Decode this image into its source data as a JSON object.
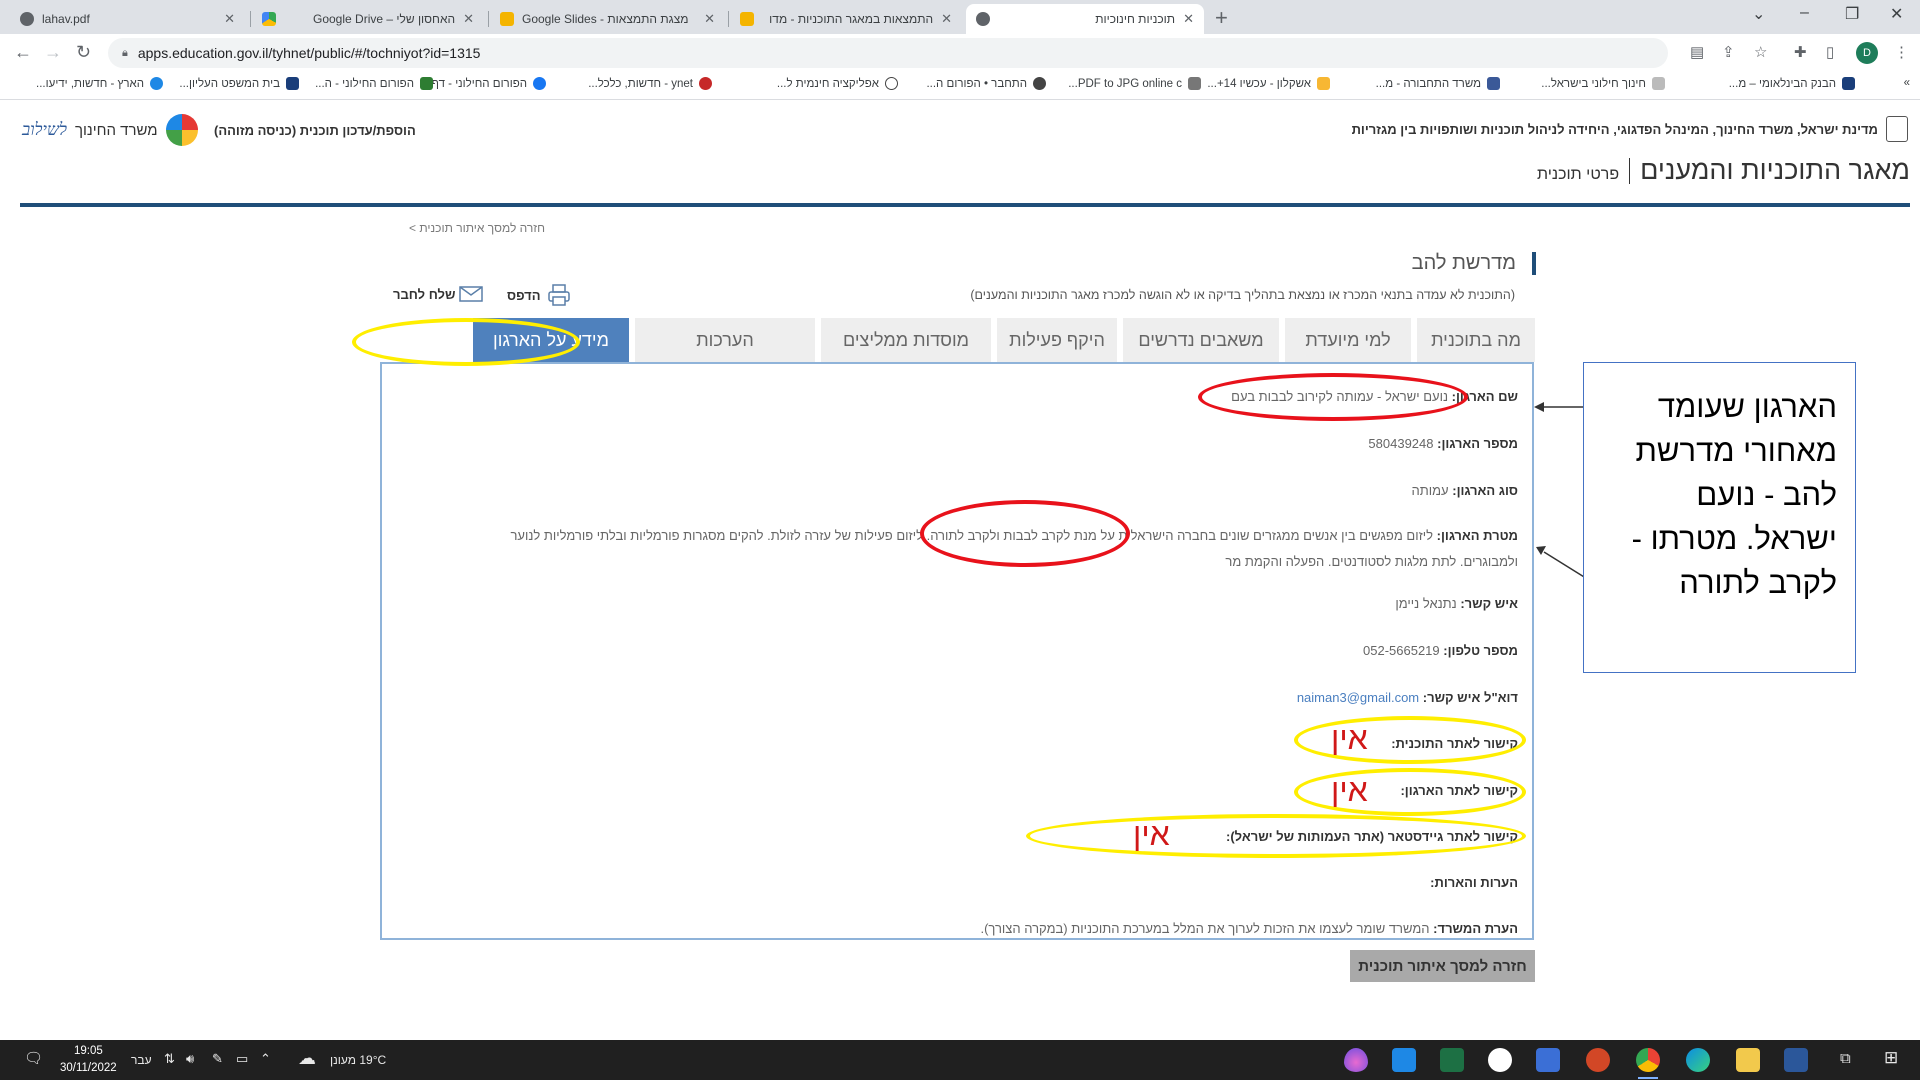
{
  "browser": {
    "tabs": [
      {
        "title": "lahav.pdf"
      },
      {
        "title": ""
      },
      {
        "title": "Google Drive – האחסון שלי"
      },
      {
        "title": "Google Slides - מצגת התמצאות"
      },
      {
        "title": "התמצאות במאגר התוכניות - מדו"
      },
      {
        "title": "תוכניות חינוכיות"
      }
    ],
    "new_tab": "+",
    "url": "apps.education.gov.il/tyhnet/public/#/tochniyot?id=1315",
    "profile_initial": "D",
    "bookmarks": [
      {
        "label": "הבנק הבינלאומי – מ..."
      },
      {
        "label": "חינוך חילוני בישראל..."
      },
      {
        "label": "משרד התחבורה - מ..."
      },
      {
        "label": "אשקלון - עכשיו 14+..."
      },
      {
        "label": "PDF to JPG online c..."
      },
      {
        "label": "התחבר • הפורום ה..."
      },
      {
        "label": "אפליקציה חינמית ל..."
      },
      {
        "label": "ynet - חדשות, כלכל..."
      },
      {
        "label": "הפורום החילוני - דף..."
      },
      {
        "label": "הפורום החילוני - ה..."
      },
      {
        "label": "בית המשפט העליון..."
      },
      {
        "label": "הארץ - חדשות, ידיעו..."
      }
    ],
    "more_bookmarks": "»"
  },
  "header": {
    "gov_line": "מדינת ישראל, משרד החינוך, המינהל הפדגוגי, היחידה לניהול תוכניות ושותפויות בין מגזריות",
    "ministry_name": "משרד החינוך",
    "ministry_slogan": "לשילוב",
    "add_update_link": "הוספת/עדכון תוכנית (כניסה מזוהה)",
    "db_title": "מאגר התוכניות והמענים",
    "db_subtitle": "פרטי תוכנית"
  },
  "program": {
    "back_link": "חזרה למסך איתור תוכנית >",
    "title": "מדרשת להב",
    "notice": "(התוכנית לא עמדה בתנאי המכרז או נמצאת בתהליך בדיקה או לא הוגשה למכרז מאגר התוכניות והמענים)",
    "print_label": "הדפס",
    "send_label": "שלח לחבר",
    "tabs": [
      {
        "label": "מה בתוכנית"
      },
      {
        "label": "למי מיועדת"
      },
      {
        "label": "משאבים נדרשים"
      },
      {
        "label": "היקף פעילות"
      },
      {
        "label": "מוסדות ממליצים"
      },
      {
        "label": "הערכות"
      },
      {
        "label": "מידע על הארגון"
      }
    ],
    "active_tab": "מידע על הארגון",
    "org": {
      "name_label": "שם הארגון:",
      "name_value": "נועם ישראל - עמותה לקירוב לבבות בעם",
      "number_label": "מספר הארגון:",
      "number_value": "580439248",
      "type_label": "סוג הארגון:",
      "type_value": "עמותה",
      "goal_label": "מטרת הארגון:",
      "goal_value": "ליזום מפגשים בין אנשים ממגזרים שונים בחברה הישראלית על מנת לקרב לבבות ולקרב לתורה. ליזום פעילות של עזרה לזולת. להקים מסגרות פורמליות ובלתי פורמליות לנוער ולמבוגרים. לתת מלגות לסטודנטים. הפעלה והקמת מר",
      "contact_label": "איש קשר:",
      "contact_value": "נתנאל ניימן",
      "phone_label": "מספר טלפון:",
      "phone_value": "052-5665219",
      "email_label": "דוא\"ל איש קשר:",
      "email_value": "naiman3@gmail.com",
      "program_site_label": "קישור לאתר התוכנית:",
      "org_site_label": "קישור לאתר הארגון:",
      "guidestar_label": "קישור לאתר גיידסטאר (אתר העמותות של ישראל):",
      "remarks_label": "הערות והארות:",
      "ministry_note_label": "הערת המשרד:",
      "ministry_note_value": "המשרד שומר לעצמו את הזכות לערוך את המלל במערכת התוכניות (במקרה הצורך)."
    },
    "back_button": "חזרה למסך איתור תוכנית"
  },
  "annotations": {
    "note_box": "הארגון שעומד מאחורי מדרשת להב - נועם ישראל. מטרתו - לקרב לתורה",
    "none_label": "אין",
    "colors": {
      "red": "#e8121b",
      "yellow": "#ffee00",
      "note_border": "#4472c4"
    }
  },
  "taskbar": {
    "weather": "19°C מעונן",
    "language": "עבר",
    "time": "19:05",
    "date": "30/11/2022"
  },
  "colors": {
    "accent": "#1f4e79",
    "active_tab": "#4f81bd",
    "panel_border": "#8fb3d9"
  }
}
